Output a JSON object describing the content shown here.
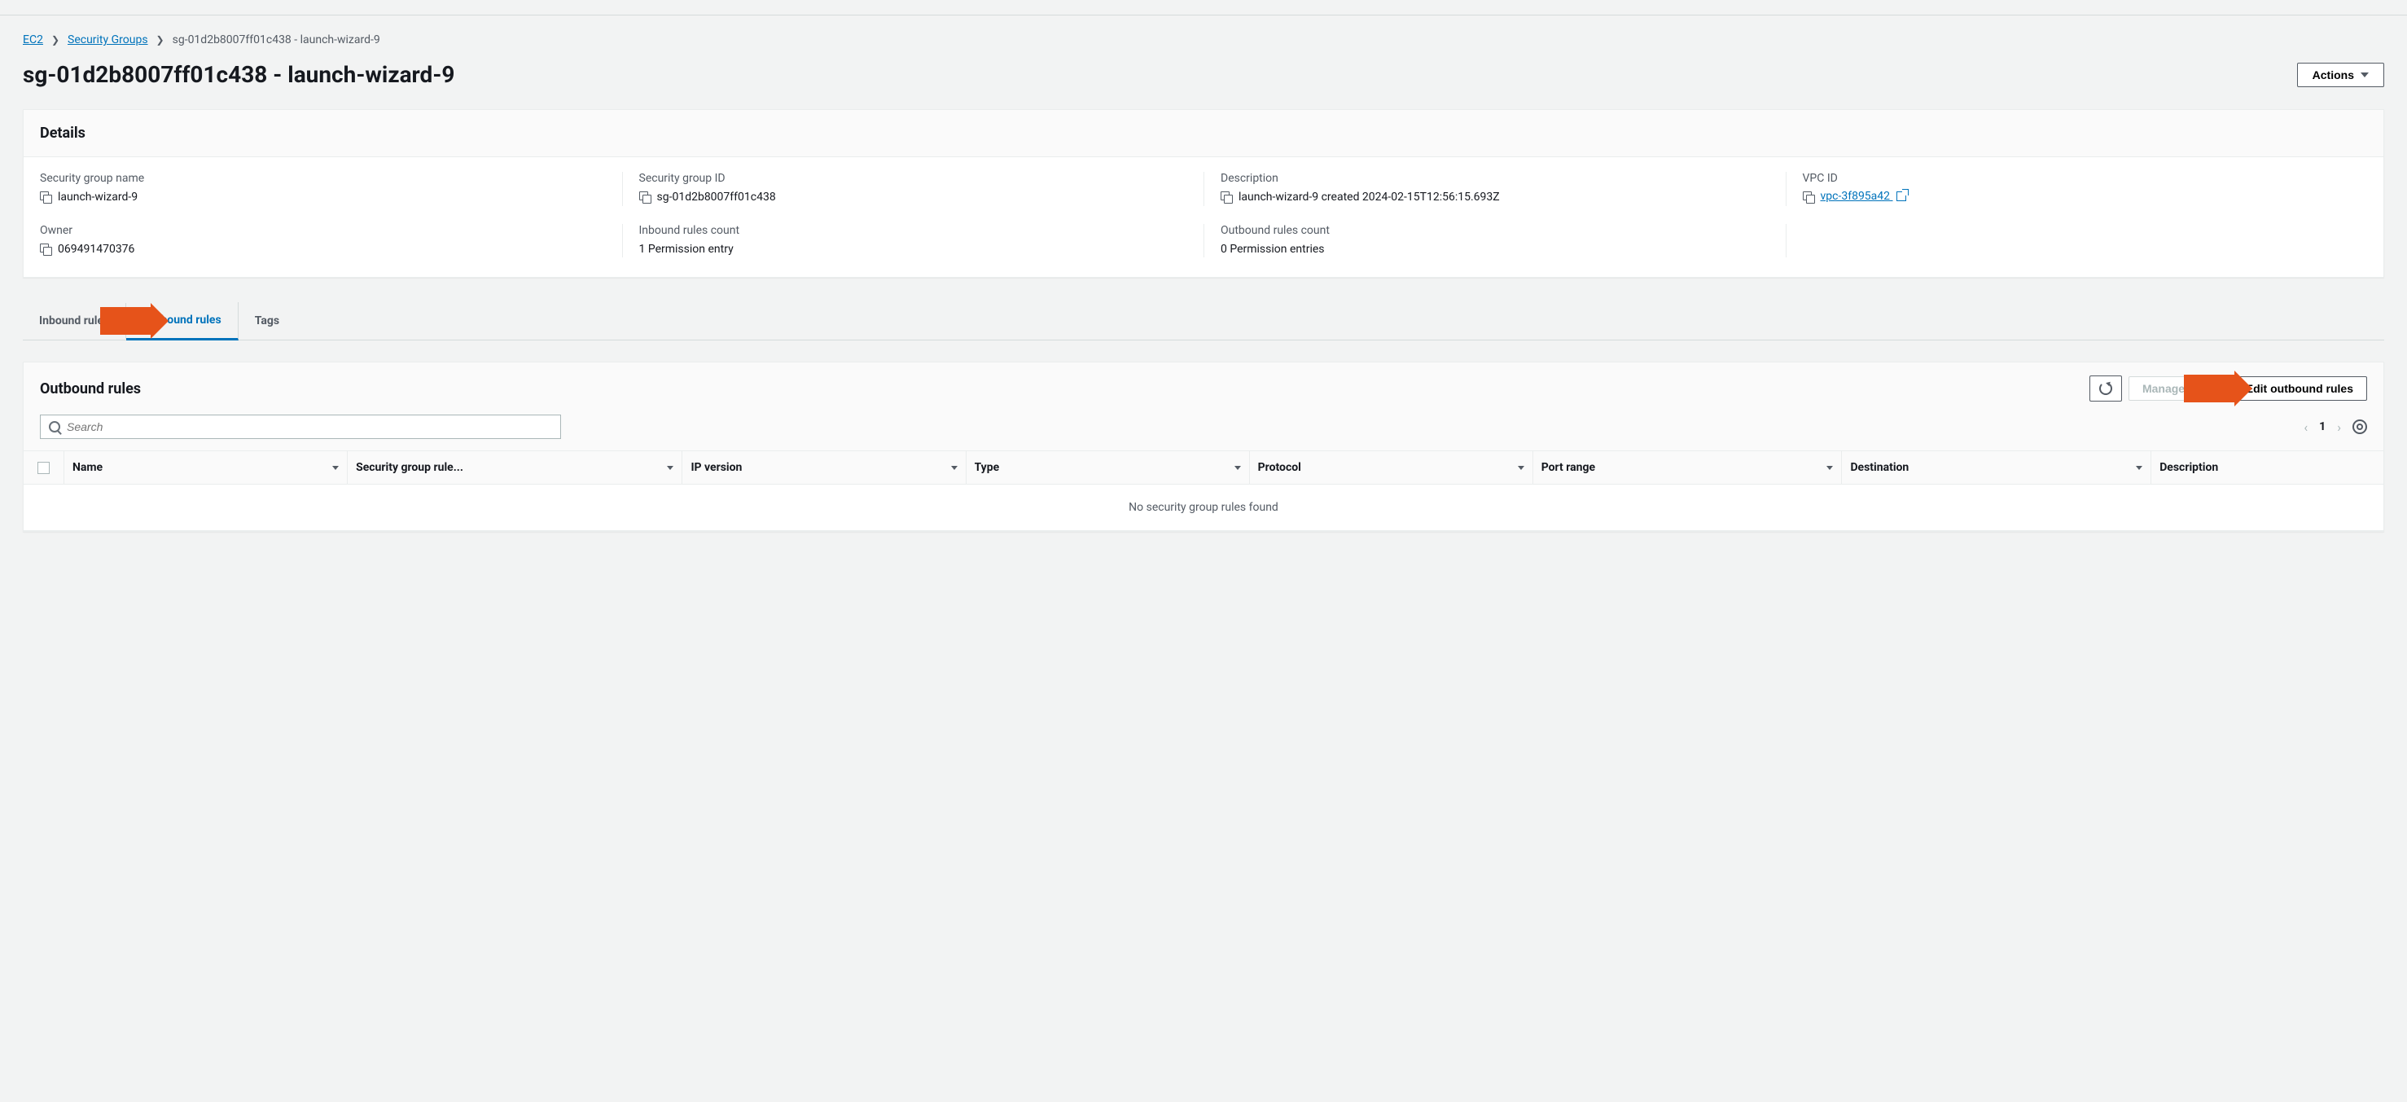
{
  "breadcrumb": {
    "root": "EC2",
    "section": "Security Groups",
    "current": "sg-01d2b8007ff01c438 - launch-wizard-9"
  },
  "page_title": "sg-01d2b8007ff01c438 - launch-wizard-9",
  "actions_label": "Actions",
  "details": {
    "heading": "Details",
    "fields": {
      "name_label": "Security group name",
      "name_value": "launch-wizard-9",
      "id_label": "Security group ID",
      "id_value": "sg-01d2b8007ff01c438",
      "desc_label": "Description",
      "desc_value": "launch-wizard-9 created 2024-02-15T12:56:15.693Z",
      "vpc_label": "VPC ID",
      "vpc_value": "vpc-3f895a42",
      "owner_label": "Owner",
      "owner_value": "069491470376",
      "inbound_count_label": "Inbound rules count",
      "inbound_count_value": "1 Permission entry",
      "outbound_count_label": "Outbound rules count",
      "outbound_count_value": "0 Permission entries"
    }
  },
  "tabs": {
    "inbound": "Inbound rules",
    "outbound": "Outbound rules",
    "tags": "Tags"
  },
  "rules": {
    "heading": "Outbound rules",
    "manage_label": "Manage tags",
    "edit_label": "Edit outbound rules",
    "search_placeholder": "Search",
    "page_number": "1",
    "columns": {
      "name": "Name",
      "sgrule": "Security group rule...",
      "ipver": "IP version",
      "type": "Type",
      "protocol": "Protocol",
      "portrange": "Port range",
      "destination": "Destination",
      "description": "Description"
    },
    "empty": "No security group rules found"
  }
}
